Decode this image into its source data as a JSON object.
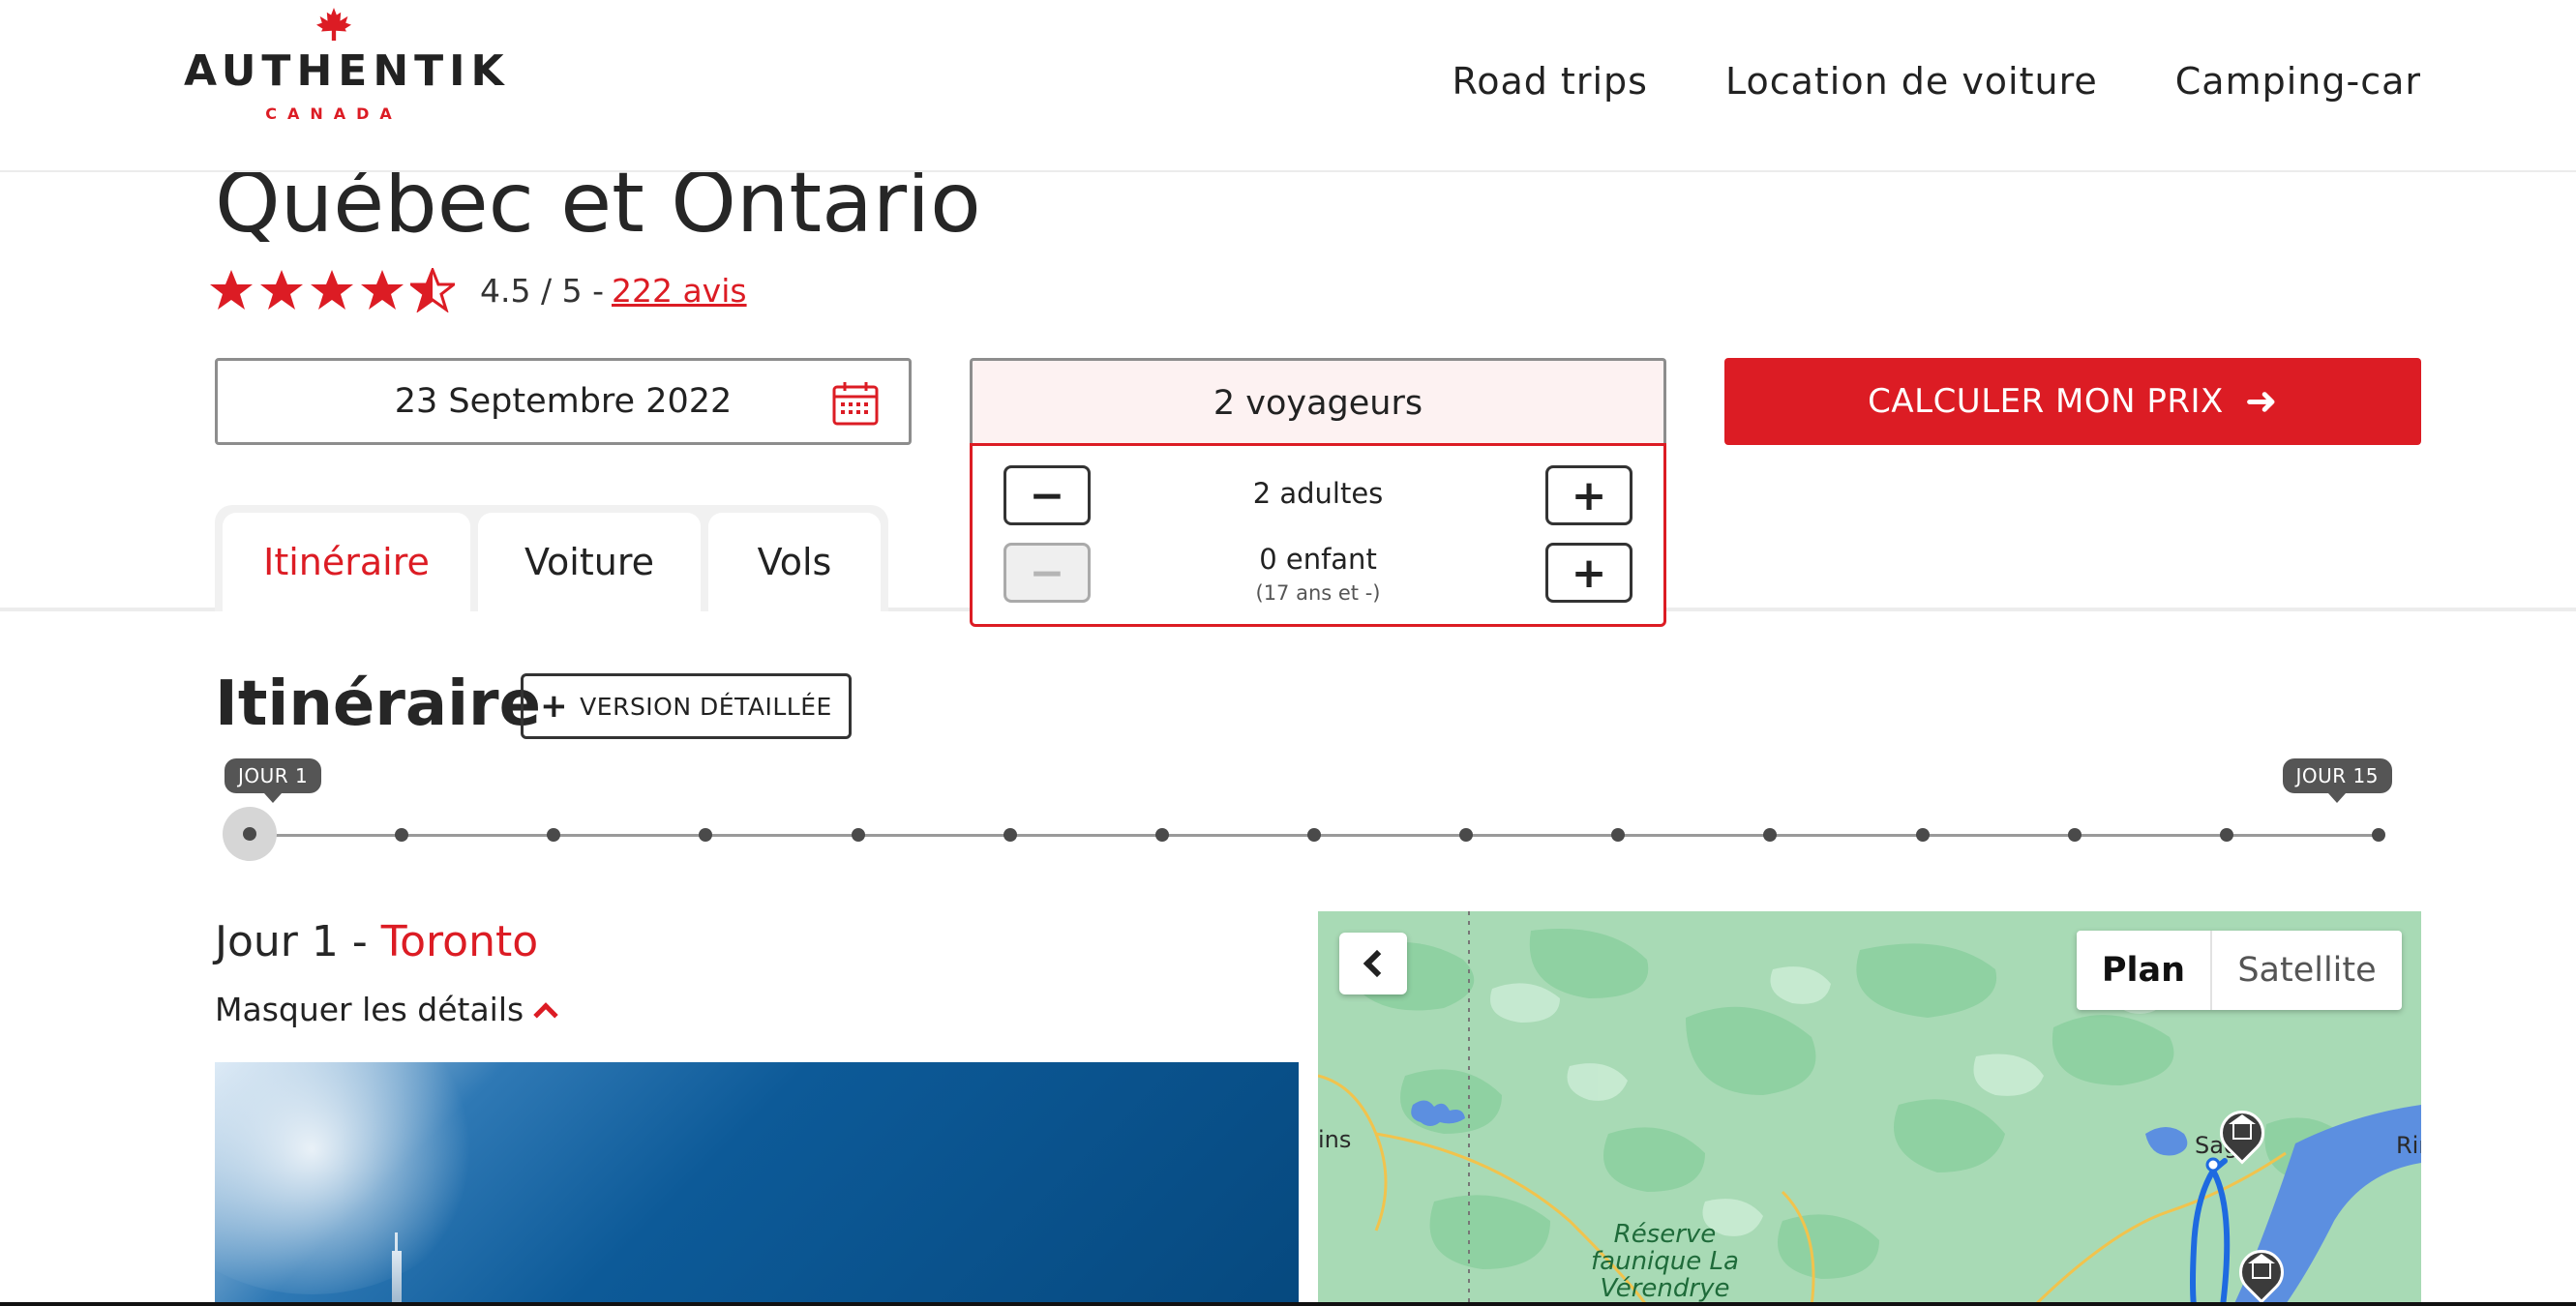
{
  "header": {
    "brand": "AUTHENTIK",
    "brand_country": "CANADA",
    "nav": [
      {
        "label": "Road trips"
      },
      {
        "label": "Location de voiture"
      },
      {
        "label": "Camping-car"
      }
    ]
  },
  "trip": {
    "title": "Québec et Ontario",
    "rating_value": 4.5,
    "rating_max": 5,
    "rating_text": "4.5 / 5 -",
    "reviews_label": "222 avis"
  },
  "booking": {
    "date": "23 Septembre 2022",
    "travelers_label": "2 voyageurs",
    "adults_label": "2 adultes",
    "children_label": "0 enfant",
    "children_hint": "(17 ans et -)",
    "minus_symbol": "−",
    "plus_symbol": "+",
    "cta_label": "CALCULER MON PRIX",
    "cta_arrow": "➜"
  },
  "tabs": [
    {
      "label": "Itinéraire"
    },
    {
      "label": "Voiture"
    },
    {
      "label": "Vols"
    }
  ],
  "itinerary": {
    "title": "Itinéraire",
    "detailed_label": "VERSION DÉTAILLÉE",
    "detailed_plus": "+",
    "timeline_start": "JOUR 1",
    "timeline_end": "JOUR 15",
    "day_count": 15,
    "active_day": 1
  },
  "day": {
    "prefix": "Jour 1 - ",
    "city": "Toronto",
    "toggle_label": "Masquer les détails"
  },
  "map": {
    "type_plan": "Plan",
    "type_satellite": "Satellite",
    "labels": {
      "left_partial": "ins",
      "park": "Réserve\nfaunique La\nVérendrye",
      "city_partial": "Sagu",
      "right_partial": "Rin"
    }
  },
  "colors": {
    "accent": "#dc1c24",
    "text": "#222222",
    "map_land": "#a8dab5",
    "map_forest": "#8fd1a2",
    "map_water": "#5c8fe0",
    "route": "#1e6ae0"
  },
  "icons": {
    "calendar": "calendar-icon",
    "arrow": "arrow-right-icon",
    "star": "star-icon",
    "chevron_up": "chevron-up-icon",
    "chevron_left": "chevron-left-icon",
    "lodging": "lodging-pin-icon"
  }
}
